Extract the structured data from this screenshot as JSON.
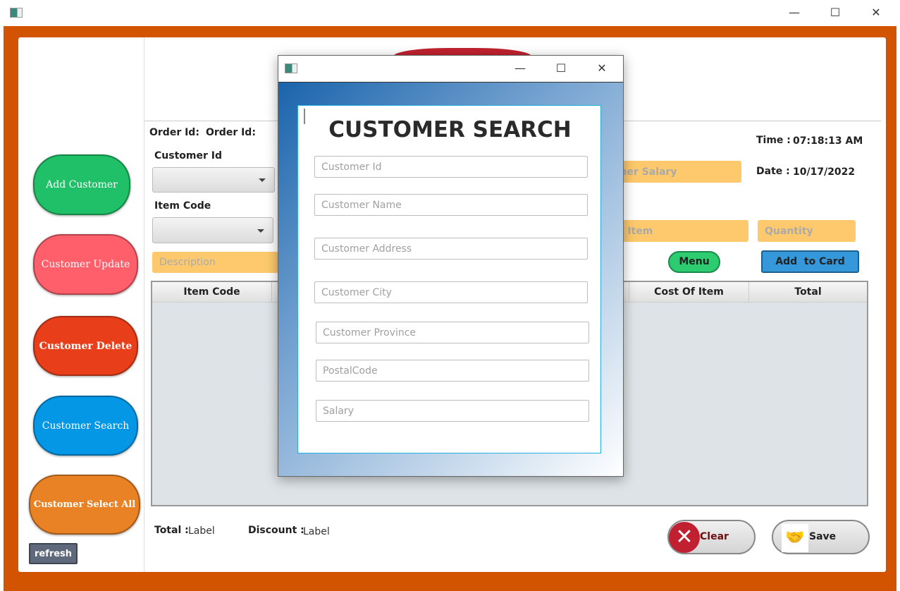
{
  "window": {
    "minimize": "—",
    "maximize": "☐",
    "close": "✕"
  },
  "sidebar": {
    "items": [
      {
        "label": "Add Customer",
        "color": "#20c068"
      },
      {
        "label": "Customer Update",
        "color": "#ff5f6a"
      },
      {
        "label": "Customer Delete",
        "color": "#e83f1a"
      },
      {
        "label": "Customer Search",
        "color": "#0497e6"
      },
      {
        "label": "Customer Select All",
        "color": "#e88225"
      }
    ],
    "refresh": "refresh"
  },
  "form": {
    "order_id_label": "Order Id:",
    "order_id_value": "Order Id:",
    "customer_id_label": "Customer Id",
    "item_code_label": "Item Code",
    "description_placeholder": "Description",
    "salary_placeholder": "Customer Salary",
    "cost_placeholder": "Cost of Item",
    "quantity_placeholder": "Quantity",
    "menu_button": "Menu",
    "add_to_card_button": "Add  to Card",
    "time_label": "Time :",
    "time_value": "07:18:13 AM",
    "date_label": "Date :",
    "date_value": "10/17/2022"
  },
  "table": {
    "columns": [
      "Item Code",
      "Cost Of Item",
      "Total"
    ]
  },
  "footer": {
    "total_label": "Total :",
    "total_value": "Label",
    "discount_label": "Discount :",
    "discount_value": "Label",
    "clear_button": "Clear",
    "save_button": "Save"
  },
  "dialog": {
    "title": "CUSTOMER SEARCH",
    "fields": [
      "Customer Id",
      "Customer Name",
      "Customer Address",
      "Customer City",
      "Customer Province",
      "PostalCode",
      "Salary"
    ]
  },
  "colors": {
    "frame": "#d35400",
    "field": "#fdc96c",
    "accent_green": "#2ecc71",
    "accent_blue": "#3498db"
  }
}
